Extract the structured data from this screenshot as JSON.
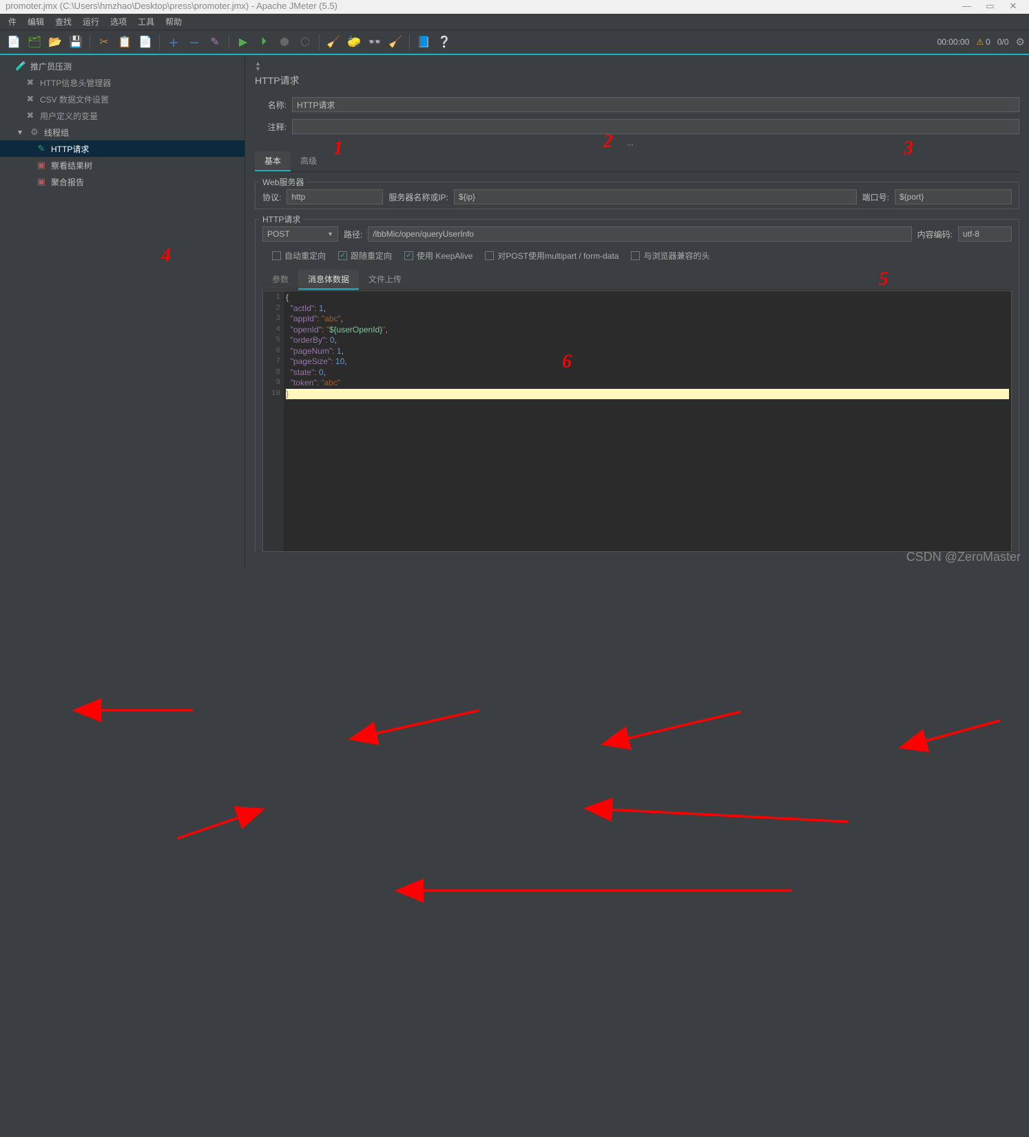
{
  "title": "promoter.jmx (C:\\Users\\hmzhao\\Desktop\\press\\promoter.jmx) - Apache JMeter (5.5)",
  "menu": [
    "件",
    "编辑",
    "查找",
    "运行",
    "选项",
    "工具",
    "帮助"
  ],
  "toolbar_right": {
    "time": "00:00:00",
    "warn": "0",
    "ratio": "0/0"
  },
  "tree": [
    {
      "indent": 0,
      "icon": "🧪",
      "label": "推广员压测",
      "color": "#bbb",
      "tw": 16
    },
    {
      "indent": 1,
      "icon": "✖",
      "label": "HTTP信息头管理器",
      "color": "#999",
      "tw": 30
    },
    {
      "indent": 1,
      "icon": "✖",
      "label": "CSV 数据文件设置",
      "color": "#999",
      "tw": 30
    },
    {
      "indent": 1,
      "icon": "✖",
      "label": "用户定义的变量",
      "color": "#999",
      "tw": 30
    },
    {
      "indent": 1,
      "icon": "⚙",
      "label": "线程组",
      "color": "#bbb",
      "tw": 30,
      "expander": "▾"
    },
    {
      "indent": 2,
      "icon": "✎",
      "label": "HTTP请求",
      "color": "#fff",
      "tw": 46,
      "selected": true,
      "iconcolor": "#2e9e6a"
    },
    {
      "indent": 2,
      "icon": "▣",
      "label": "察看结果树",
      "color": "#bbb",
      "tw": 46,
      "iconcolor": "#b05a5a"
    },
    {
      "indent": 2,
      "icon": "▣",
      "label": "聚合报告",
      "color": "#bbb",
      "tw": 46,
      "iconcolor": "#b05a5a"
    }
  ],
  "panel": {
    "title": "HTTP请求",
    "name_label": "名称:",
    "name_value": "HTTP请求",
    "comment_label": "注释:",
    "comment_value": "",
    "tabs": [
      "基本",
      "高级"
    ],
    "webserver": {
      "legend": "Web服务器",
      "protocol_label": "协议:",
      "protocol": "http",
      "server_label": "服务器名称或IP:",
      "server": "${ip}",
      "port_label": "端口号:",
      "port": "${port}"
    },
    "http": {
      "legend": "HTTP请求",
      "method": "POST",
      "path_label": "路径:",
      "path": "/lbbMic/open/queryUserInfo",
      "enc_label": "内容编码:",
      "enc": "utf-8"
    },
    "checks": {
      "auto": "自动重定向",
      "follow": "跟随重定向",
      "keepalive": "使用 KeepAlive",
      "multipart": "对POST使用multipart / form-data",
      "browser": "与浏览器兼容的头"
    },
    "subtabs": [
      "参数",
      "消息体数据",
      "文件上传"
    ],
    "body_lines": [
      "{",
      "  \"actId\": 1,",
      "  \"appId\": \"abc\",",
      "  \"openId\": \"${userOpenId}\",",
      "  \"orderBy\": 0,",
      "  \"pageNum\": 1,",
      "  \"pageSize\": 10,",
      "  \"state\": 0,",
      "  \"token\": \"abc\"",
      "}"
    ]
  },
  "annotations": [
    "1",
    "2",
    "3",
    "4",
    "5",
    "6"
  ],
  "watermark": "CSDN @ZeroMaster"
}
